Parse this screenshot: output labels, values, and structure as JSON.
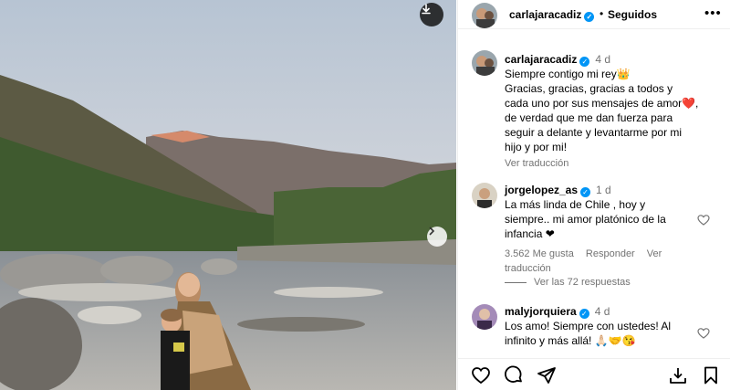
{
  "header": {
    "username": "carlajaracadiz",
    "follow_status": "Seguidos"
  },
  "caption": {
    "username": "carlajaracadiz",
    "time": "4 d",
    "lines": [
      "Siempre contigo mi rey👑",
      "Gracias, gracias, gracias a todos y",
      "cada uno por sus mensajes de amor❤️,",
      "de verdad que me dan fuerza para",
      "seguir a delante y levantarme por mi",
      "hijo y por mi!"
    ],
    "see_translation": "Ver traducción"
  },
  "comments": [
    {
      "username": "jorgelopez_as",
      "time": "1 d",
      "lines": [
        "La más linda de Chile , hoy y",
        "siempre.. mi amor platónico de la",
        "infancia ❤"
      ],
      "likes": "3.562 Me gusta",
      "reply": "Responder",
      "see_translation": "Ver traducción",
      "replies_link": "Ver las 72 respuestas"
    },
    {
      "username": "malyjorquiera",
      "time": "4 d",
      "lines": [
        "Los amo! Siempre con ustedes! Al",
        "infinito y más allá! 🙏🏻🤝😘"
      ]
    }
  ],
  "icons": {
    "download": "download-icon",
    "next": "chevron-right-icon",
    "more": "more-icon",
    "heart": "heart-icon",
    "comment": "comment-icon",
    "share": "share-icon",
    "save": "bookmark-icon"
  },
  "colors": {
    "verified": "#0095f6",
    "muted": "#737373"
  }
}
